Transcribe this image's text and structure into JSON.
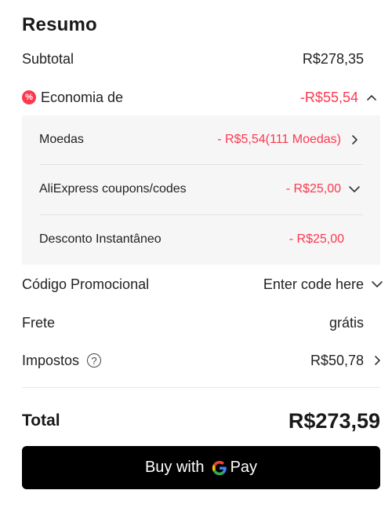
{
  "summary": {
    "title": "Resumo",
    "subtotal": {
      "label": "Subtotal",
      "value": "R$278,35"
    },
    "savings": {
      "label": "Economia de",
      "value": "-R$55,54",
      "items": [
        {
          "label": "Moedas",
          "value": "- R$5,54(111 Moedas)"
        },
        {
          "label": "AliExpress coupons/codes",
          "value": "- R$25,00"
        },
        {
          "label": "Desconto Instantâneo",
          "value": "- R$25,00"
        }
      ]
    },
    "promo": {
      "label": "Código Promocional",
      "value": "Enter code here"
    },
    "shipping": {
      "label": "Frete",
      "value": "grátis"
    },
    "taxes": {
      "label": "Impostos",
      "value": "R$50,78",
      "help": "?"
    },
    "total": {
      "label": "Total",
      "value": "R$273,59"
    },
    "pay_button": {
      "prefix": "Buy with",
      "brand": "Pay"
    }
  },
  "colors": {
    "accent_red": "#fd384f",
    "button_bg": "#000000"
  }
}
